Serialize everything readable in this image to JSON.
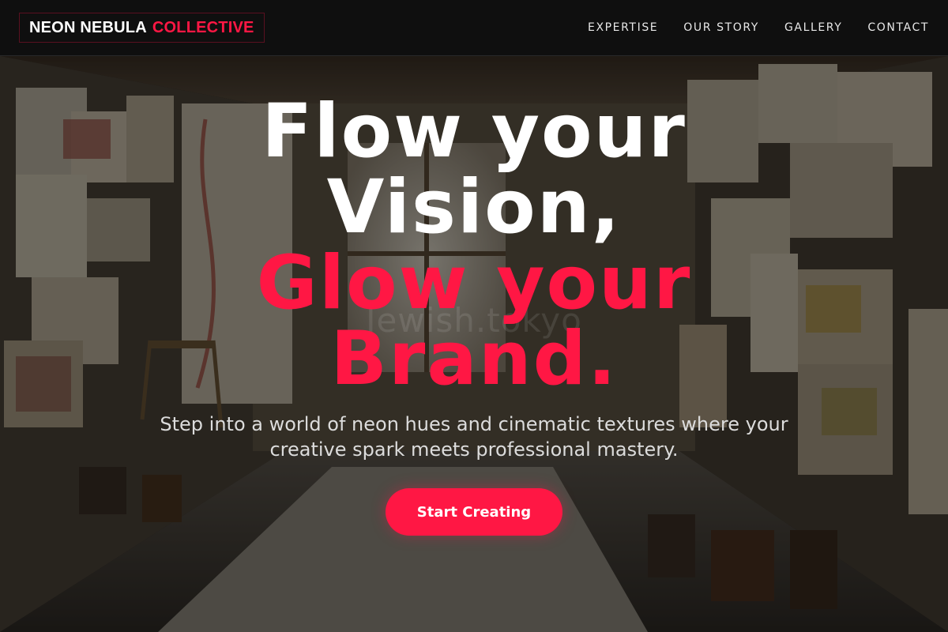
{
  "nav": {
    "logo_primary": "NEON NEBULA",
    "logo_accent": "COLLECTIVE",
    "links": [
      "EXPERTISE",
      "OUR STORY",
      "GALLERY",
      "CONTACT"
    ]
  },
  "hero": {
    "headline_line1": "Flow your",
    "headline_line2": "Vision,",
    "headline_line3": "Glow your",
    "headline_line4": "Brand.",
    "watermark": "Jewish.tokyo",
    "subtitle": "Step into a world of neon hues and cinematic textures where your creative spark meets professional mastery.",
    "cta_label": "Start Creating",
    "background_image": "art-studio-photo"
  },
  "colors": {
    "accent": "#ff1744",
    "nav_bg": "#0f0f0f",
    "text_light": "#ffffff"
  }
}
